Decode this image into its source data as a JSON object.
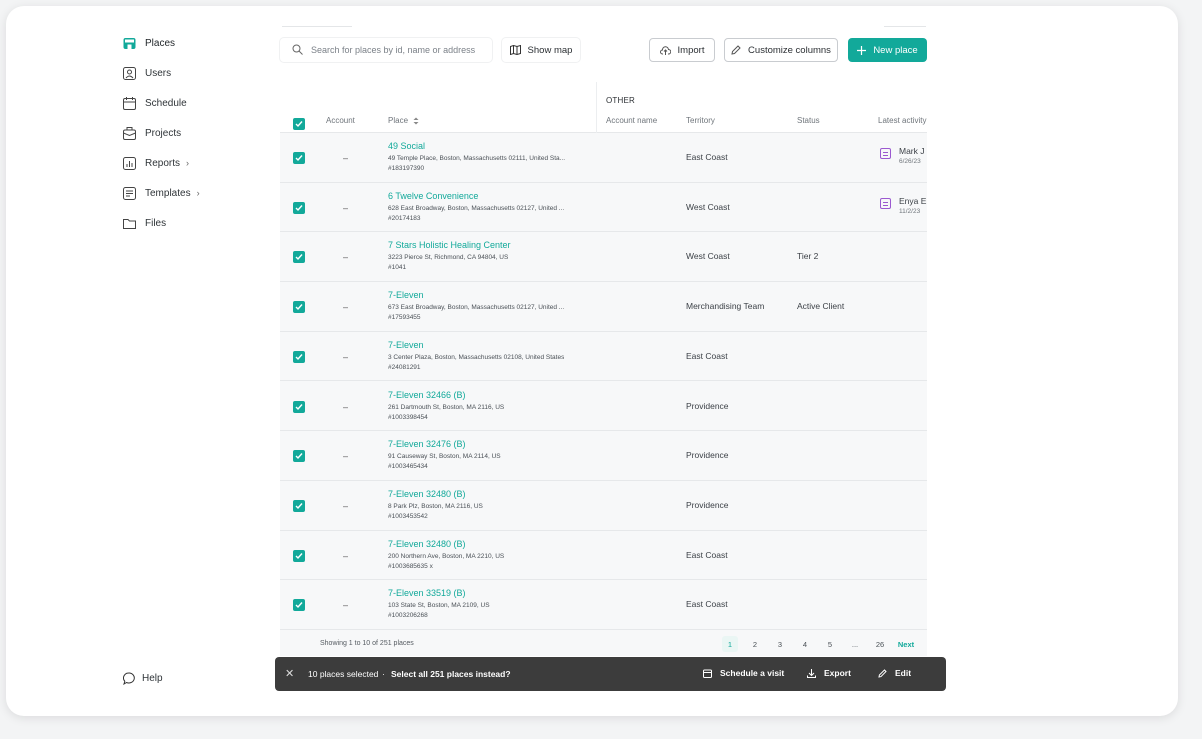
{
  "sidebar": {
    "items": [
      {
        "label": "Places",
        "icon": "store-icon"
      },
      {
        "label": "Users",
        "icon": "user-icon"
      },
      {
        "label": "Schedule",
        "icon": "calendar-icon"
      },
      {
        "label": "Projects",
        "icon": "briefcase-icon"
      },
      {
        "label": "Reports",
        "icon": "chart-icon"
      },
      {
        "label": "Templates",
        "icon": "template-icon"
      },
      {
        "label": "Files",
        "icon": "folder-icon"
      }
    ],
    "help_label": "Help"
  },
  "toolbar": {
    "search_placeholder": "Search for places by id, name or address",
    "show_map_label": "Show map",
    "import_label": "Import",
    "customize_label": "Customize columns",
    "new_place_label": "New place"
  },
  "table": {
    "group_header": "OTHER",
    "headers": {
      "account": "Account",
      "place": "Place",
      "account_name": "Account name",
      "territory": "Territory",
      "status": "Status",
      "latest_activity": "Latest activity"
    },
    "rows": [
      {
        "account": "–",
        "name": "49 Social",
        "address": "49 Temple Place, Boston, Massachusetts 02111, United Sta...",
        "id": "#183197390",
        "territory": "East Coast",
        "status": "",
        "activity_who": "Mark J",
        "activity_when": "6/26/23"
      },
      {
        "account": "–",
        "name": "6 Twelve Convenience",
        "address": "628 East Broadway, Boston, Massachusetts 02127, United ...",
        "id": "#20174183",
        "territory": "West Coast",
        "status": "",
        "activity_who": "Enya E",
        "activity_when": "11/2/23"
      },
      {
        "account": "–",
        "name": "7 Stars Holistic Healing Center",
        "address": "3223 Pierce St, Richmond, CA 94804, US",
        "id": "#1041",
        "territory": "West Coast",
        "status": "Tier 2",
        "activity_who": "",
        "activity_when": ""
      },
      {
        "account": "–",
        "name": "7-Eleven",
        "address": "673 East Broadway, Boston, Massachusetts 02127, United ...",
        "id": "#17593455",
        "territory": "Merchandising Team",
        "status": "Active Client",
        "activity_who": "",
        "activity_when": ""
      },
      {
        "account": "–",
        "name": "7-Eleven",
        "address": "3 Center Plaza, Boston, Massachusetts 02108, United States",
        "id": "#24081291",
        "territory": "East Coast",
        "status": "",
        "activity_who": "",
        "activity_when": ""
      },
      {
        "account": "–",
        "name": "7-Eleven 32466 (B)",
        "address": "261 Dartmouth St, Boston, MA 2116, US",
        "id": "#1003398454",
        "territory": "Providence",
        "status": "",
        "activity_who": "",
        "activity_when": ""
      },
      {
        "account": "–",
        "name": "7-Eleven 32476 (B)",
        "address": "91 Causeway St, Boston, MA 2114, US",
        "id": "#1003465434",
        "territory": "Providence",
        "status": "",
        "activity_who": "",
        "activity_when": ""
      },
      {
        "account": "–",
        "name": "7-Eleven 32480 (B)",
        "address": "8 Park Plz, Boston, MA 2116, US",
        "id": "#1003453542",
        "territory": "Providence",
        "status": "",
        "activity_who": "",
        "activity_when": ""
      },
      {
        "account": "–",
        "name": "7-Eleven 32480 (B)",
        "address": "200 Northern Ave, Boston, MA 2210, US",
        "id": "#1003685635 x",
        "territory": "East Coast",
        "status": "",
        "activity_who": "",
        "activity_when": ""
      },
      {
        "account": "–",
        "name": "7-Eleven 33519 (B)",
        "address": "103 State St, Boston, MA 2109, US",
        "id": "#1003206268",
        "territory": "East Coast",
        "status": "",
        "activity_who": "",
        "activity_when": ""
      }
    ]
  },
  "pagination": {
    "info": "Showing 1 to 10 of 251 places",
    "pages": [
      "1",
      "2",
      "3",
      "4",
      "5",
      "...",
      "26"
    ],
    "next_label": "Next",
    "current": "1"
  },
  "selection_bar": {
    "count_label": "10 places selected",
    "separator": "·",
    "select_all_label": "Select all 251 places instead?",
    "schedule_label": "Schedule a visit",
    "export_label": "Export",
    "edit_label": "Edit"
  },
  "colors": {
    "accent": "#12a99a",
    "selbar": "#3c3c3c",
    "activity_icon": "#9b59d0"
  }
}
